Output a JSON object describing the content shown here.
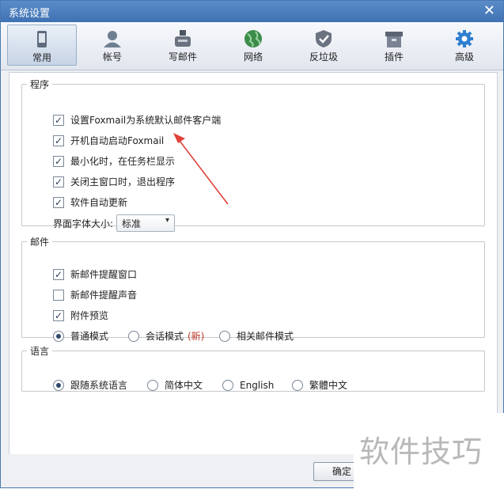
{
  "window": {
    "title": "系统设置"
  },
  "toolbar": {
    "tabs": [
      {
        "label": "常用",
        "icon": "phone-icon"
      },
      {
        "label": "帐号",
        "icon": "user-icon"
      },
      {
        "label": "写邮件",
        "icon": "compose-icon"
      },
      {
        "label": "网络",
        "icon": "globe-icon"
      },
      {
        "label": "反垃圾",
        "icon": "shield-icon"
      },
      {
        "label": "插件",
        "icon": "box-icon"
      },
      {
        "label": "高级",
        "icon": "gear-icon"
      }
    ]
  },
  "program": {
    "legend": "程序",
    "items": [
      {
        "label": "设置Foxmail为系统默认邮件客户端",
        "checked": true
      },
      {
        "label": "开机自动启动Foxmail",
        "checked": true
      },
      {
        "label": "最小化时，在任务栏显示",
        "checked": true
      },
      {
        "label": "关闭主窗口时，退出程序",
        "checked": true
      },
      {
        "label": "软件自动更新",
        "checked": true
      }
    ],
    "font_size_label": "界面字体大小:",
    "font_size_value": "标准"
  },
  "mail": {
    "legend": "邮件",
    "items": [
      {
        "label": "新邮件提醒窗口",
        "checked": true
      },
      {
        "label": "新邮件提醒声音",
        "checked": false
      },
      {
        "label": "附件预览",
        "checked": true
      }
    ],
    "modes": [
      {
        "label": "普通模式",
        "selected": true
      },
      {
        "label": "会话模式",
        "selected": false
      },
      {
        "label": "相关邮件模式",
        "selected": false
      }
    ],
    "new_tag": "(新)"
  },
  "language": {
    "legend": "语言",
    "options": [
      {
        "label": "跟随系统语言",
        "selected": true
      },
      {
        "label": "简体中文",
        "selected": false
      },
      {
        "label": "English",
        "selected": false
      },
      {
        "label": "繁體中文",
        "selected": false
      }
    ]
  },
  "buttons": {
    "ok": "确定"
  },
  "watermark": "软件技巧"
}
